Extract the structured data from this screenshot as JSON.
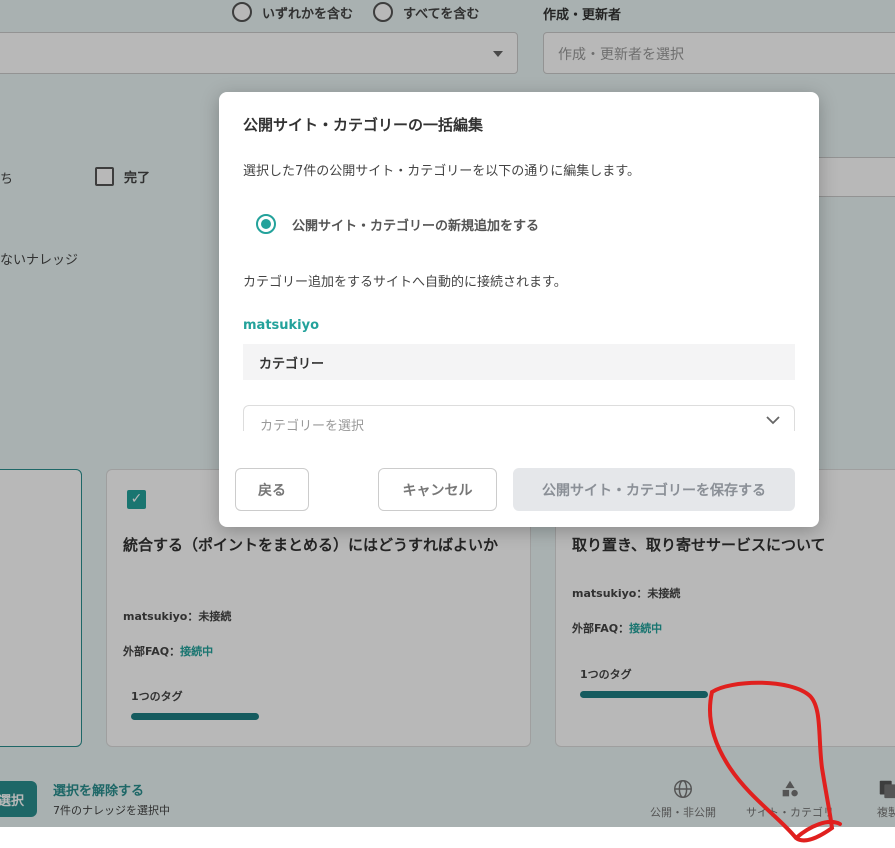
{
  "filters": {
    "match_any_label": "いずれかを含む",
    "match_all_label": "すべてを含む",
    "creator_label": "作成・更新者",
    "creator_placeholder": "作成・更新者を選択"
  },
  "status_filters": {
    "partial_label": "ち",
    "done_label": "完了",
    "knowledge_partial_label": "ないナレッジ"
  },
  "cards": [
    {
      "title": "統合する（ポイントをまとめる）にはどうすればよいか",
      "site_status_label": "matsukiyo：未接続",
      "faq_label": "外部FAQ：",
      "faq_status": "接続中",
      "tags_label": "1つのタグ"
    },
    {
      "title": "取り置き、取り寄せサービスについて",
      "site_status_label": "matsukiyo：未接続",
      "faq_label": "外部FAQ：",
      "faq_status": "接続中",
      "tags_label": "1つのタグ"
    }
  ],
  "action_bar": {
    "select_button_label": "選択",
    "deselect_label": "選択を解除する",
    "selected_count_label": "7件のナレッジを選択中",
    "tools": [
      {
        "label": "公開・非公開",
        "icon": "globe-icon"
      },
      {
        "label": "サイト・カテゴリ",
        "icon": "shapes-icon"
      },
      {
        "label": "複製",
        "icon": "copy-icon"
      }
    ]
  },
  "modal": {
    "title": "公開サイト・カテゴリーの一括編集",
    "description": "選択した7件の公開サイト・カテゴリーを以下の通りに編集します。",
    "radio_label": "公開サイト・カテゴリーの新規追加をする",
    "note": "カテゴリー追加をするサイトへ自動的に接続されます。",
    "site_name": "matsukiyo",
    "category_header": "カテゴリー",
    "category_placeholder": "カテゴリーを選択",
    "back_label": "戻る",
    "cancel_label": "キャンセル",
    "save_label": "公開サイト・カテゴリーを保存する"
  },
  "colors": {
    "accent": "#23a29b",
    "annotation": "#e0201e",
    "page_tint": "#eaf6f5"
  }
}
